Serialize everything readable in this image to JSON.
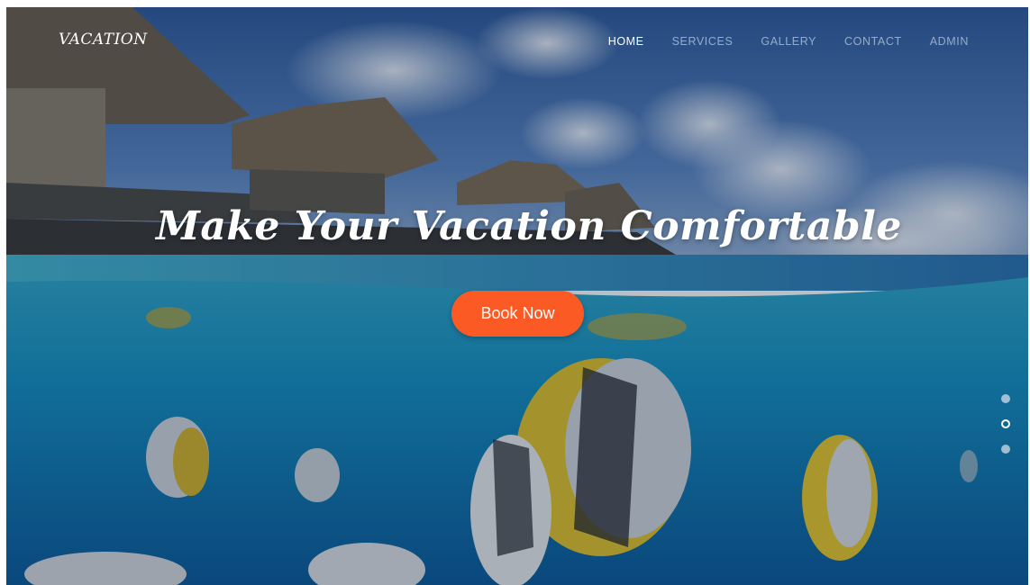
{
  "brand": {
    "logo_text": "VACATION"
  },
  "nav": {
    "items": [
      {
        "label": "HOME",
        "active": true
      },
      {
        "label": "SERVICES",
        "active": false
      },
      {
        "label": "GALLERY",
        "active": false
      },
      {
        "label": "CONTACT",
        "active": false
      },
      {
        "label": "ADMIN",
        "active": false
      }
    ]
  },
  "hero": {
    "headline": "Make Your Vacation Comfortable",
    "cta_label": "Book Now",
    "background_description": "over-under water photo: thatched overwater bungalows above, tropical butterflyfish below",
    "slider": {
      "total": 3,
      "active_index": 1
    }
  },
  "colors": {
    "accent": "#fb5a25",
    "nav_active": "#ffffff",
    "nav_inactive": "#a9b6cc",
    "sky": "#3f6fae",
    "water": "#1a86b4"
  }
}
